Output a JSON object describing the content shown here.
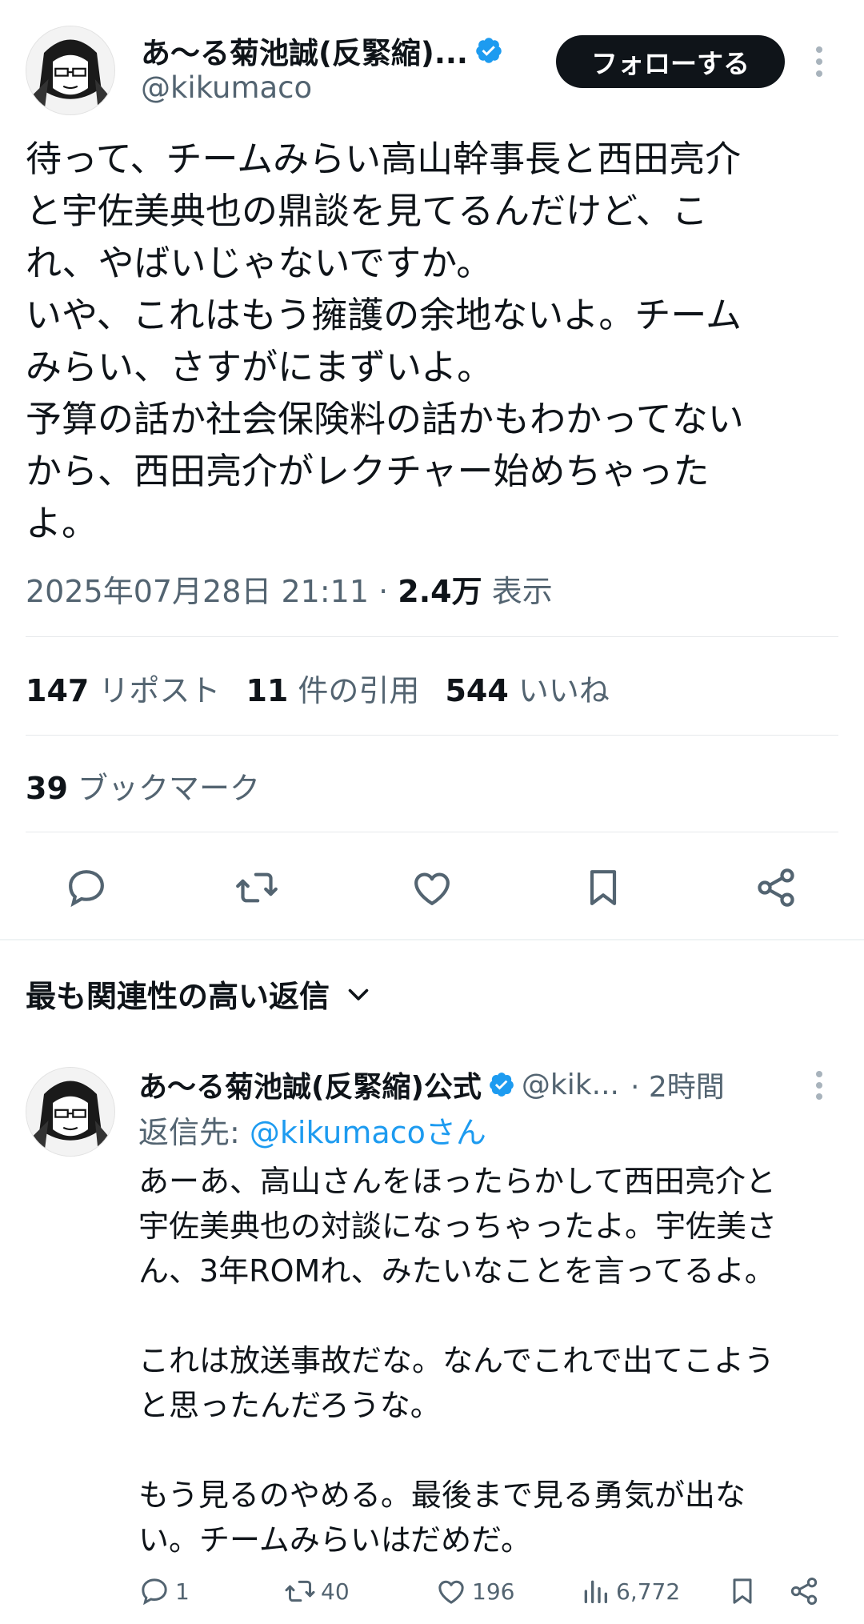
{
  "tweet": {
    "author_name": "あ〜る菊池誠(反緊縮)...",
    "author_handle": "@kikumaco",
    "follow_label": "フォローする",
    "text": "待って、チームみらい高山幹事長と西田亮介\nと宇佐美典也の鼎談を見てるんだけど、こ\nれ、やばいじゃないですか。\nいや、これはもう擁護の余地ないよ。チーム\nみらい、さすがにまずいよ。\n予算の話か社会保険料の話かもわかってない\nから、西田亮介がレクチャー始めちゃった\nよ。",
    "timestamp": "2025年07月28日 21:11",
    "separator": "·",
    "views_count": "2.4万",
    "views_label": "表示"
  },
  "stats": {
    "reposts_count": "147",
    "reposts_label": "リポスト",
    "quotes_count": "11",
    "quotes_label": "件の引用",
    "likes_count": "544",
    "likes_label": "いいね",
    "bookmarks_count": "39",
    "bookmarks_label": "ブックマーク"
  },
  "actions": [
    "reply-icon",
    "repost-icon",
    "like-icon",
    "bookmark-icon",
    "share-icon"
  ],
  "replies_section": {
    "title": "最も関連性の高い返信"
  },
  "reply": {
    "author_name": "あ〜る菊池誠(反緊縮)公式",
    "author_handle": "@kik...",
    "time": "· 2時間",
    "replying_to_prefix": "返信先: ",
    "replying_to_handle": "@kikumacoさん",
    "text": "あーあ、高山さんをほったらかして西田亮介と\n宇佐美典也の対談になっちゃったよ。宇佐美さ\nん、3年ROMれ、みたいなことを言ってるよ。\n\nこれは放送事故だな。なんでこれで出てこよう\nと思ったんだろうな。\n\nもう見るのやめる。最後まで見る勇気が出な\nい。チームみらいはだめだ。",
    "replies": "1",
    "reposts": "40",
    "likes": "196",
    "views": "6,772"
  },
  "colors": {
    "accent": "#1d9bf0",
    "text": "#0f1419",
    "secondary": "#536471",
    "divider": "#e6e9eb"
  }
}
